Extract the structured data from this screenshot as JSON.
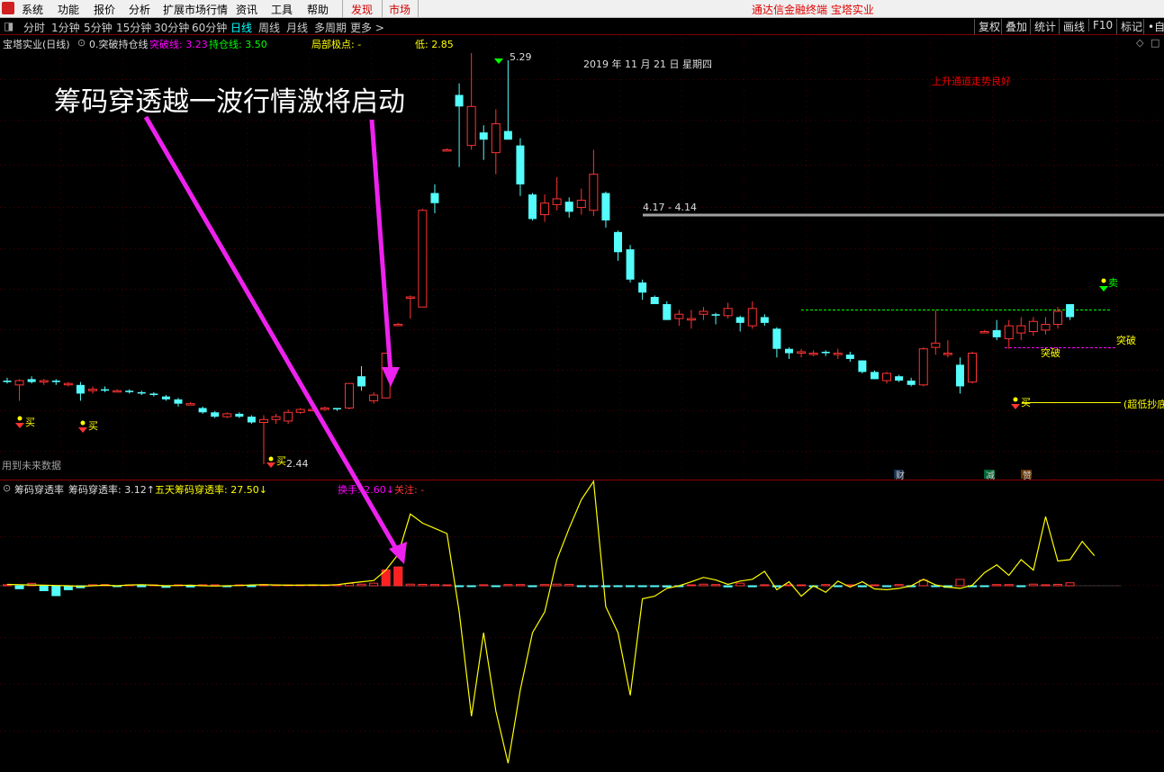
{
  "menubar": {
    "items": [
      "系统",
      "功能",
      "报价",
      "分析",
      "扩展市场行情",
      "资讯",
      "工具",
      "帮助"
    ],
    "discover": "发现",
    "market": "市场",
    "brand": "通达信金融终端  宝塔实业"
  },
  "periods": {
    "items": [
      "分时",
      "1分钟",
      "5分钟",
      "15分钟",
      "30分钟",
      "60分钟",
      "日线",
      "周线",
      "月线",
      "多周期",
      "更多 >"
    ],
    "active": "日线"
  },
  "toolbar_right": [
    "复权",
    "叠加",
    "统计",
    "画线",
    "F10",
    "标记",
    "•自"
  ],
  "main_header": {
    "stock": "宝塔实业(日线)",
    "indicator": "0.突破持仓线",
    "breakout_label": "突破线: 3.23",
    "hold_label": "持仓线: 3.50",
    "local_extreme": "局部极点: -",
    "low": "低: 2.85"
  },
  "date_label": "2019 年 11 月 21 日 星期四",
  "trend_note": "上升通道走势良好",
  "high_price": "5.29",
  "low_price": "2.44",
  "price_line_label": "4.17 - 4.14",
  "future_data_note": "用到未来数据",
  "signals": {
    "buy": "买",
    "sell": "卖",
    "breakout": "突破",
    "ultra_low": "(超低抄底"
  },
  "badges": [
    "财",
    "减",
    "赞"
  ],
  "sub_header": {
    "name": "筹码穿透率",
    "value1": "筹码穿透率: 3.12↑",
    "value2": "五天筹码穿透率: 27.50↓",
    "turnover": "换手: 2.60↓",
    "attention": "关注: -"
  },
  "annotation": "筹码穿透越一波行情激将启动",
  "colors": {
    "up": "#ff3333",
    "down": "#54fcfc",
    "yellow": "#ffff00",
    "magenta": "#ff00ff",
    "green": "#00ff00",
    "gray": "#a0a0a0"
  },
  "chart_data": {
    "type": "candlestick",
    "candles": [
      {
        "o": 3.02,
        "h": 3.04,
        "l": 3.0,
        "c": 3.01
      },
      {
        "o": 2.99,
        "h": 3.03,
        "l": 2.88,
        "c": 3.02
      },
      {
        "o": 3.03,
        "h": 3.05,
        "l": 3.0,
        "c": 3.01
      },
      {
        "o": 3.01,
        "h": 3.03,
        "l": 2.99,
        "c": 3.02
      },
      {
        "o": 3.02,
        "h": 3.03,
        "l": 2.99,
        "c": 3.01
      },
      {
        "o": 3.0,
        "h": 3.01,
        "l": 2.98,
        "c": 3.0
      },
      {
        "o": 2.99,
        "h": 3.01,
        "l": 2.88,
        "c": 2.93
      },
      {
        "o": 2.95,
        "h": 2.98,
        "l": 2.93,
        "c": 2.96
      },
      {
        "o": 2.96,
        "h": 2.98,
        "l": 2.94,
        "c": 2.95
      },
      {
        "o": 2.95,
        "h": 2.96,
        "l": 2.94,
        "c": 2.95
      },
      {
        "o": 2.95,
        "h": 2.96,
        "l": 2.93,
        "c": 2.94
      },
      {
        "o": 2.94,
        "h": 2.95,
        "l": 2.92,
        "c": 2.93
      },
      {
        "o": 2.93,
        "h": 2.94,
        "l": 2.91,
        "c": 2.92
      },
      {
        "o": 2.91,
        "h": 2.92,
        "l": 2.88,
        "c": 2.89
      },
      {
        "o": 2.89,
        "h": 2.9,
        "l": 2.84,
        "c": 2.86
      },
      {
        "o": 2.86,
        "h": 2.87,
        "l": 2.85,
        "c": 2.86
      },
      {
        "o": 2.83,
        "h": 2.84,
        "l": 2.79,
        "c": 2.8
      },
      {
        "o": 2.8,
        "h": 2.81,
        "l": 2.76,
        "c": 2.77
      },
      {
        "o": 2.77,
        "h": 2.8,
        "l": 2.76,
        "c": 2.79
      },
      {
        "o": 2.79,
        "h": 2.8,
        "l": 2.76,
        "c": 2.77
      },
      {
        "o": 2.77,
        "h": 2.78,
        "l": 2.72,
        "c": 2.73
      },
      {
        "o": 2.73,
        "h": 2.78,
        "l": 2.44,
        "c": 2.75
      },
      {
        "o": 2.75,
        "h": 2.79,
        "l": 2.72,
        "c": 2.77
      },
      {
        "o": 2.74,
        "h": 2.82,
        "l": 2.72,
        "c": 2.8
      },
      {
        "o": 2.8,
        "h": 2.83,
        "l": 2.79,
        "c": 2.82
      },
      {
        "o": 2.82,
        "h": 2.84,
        "l": 2.81,
        "c": 2.82
      },
      {
        "o": 2.82,
        "h": 2.84,
        "l": 2.81,
        "c": 2.83
      },
      {
        "o": 2.83,
        "h": 2.83,
        "l": 2.81,
        "c": 2.82
      },
      {
        "o": 2.83,
        "h": 3.0,
        "l": 2.82,
        "c": 3.0
      },
      {
        "o": 3.05,
        "h": 3.12,
        "l": 2.95,
        "c": 2.98
      },
      {
        "o": 2.88,
        "h": 2.94,
        "l": 2.86,
        "c": 2.92
      },
      {
        "o": 2.9,
        "h": 3.21,
        "l": 2.9,
        "c": 3.21
      },
      {
        "o": 3.41,
        "h": 3.42,
        "l": 3.4,
        "c": 3.41
      },
      {
        "o": 3.6,
        "h": 3.61,
        "l": 3.45,
        "c": 3.6
      },
      {
        "o": 3.53,
        "h": 4.21,
        "l": 3.53,
        "c": 4.2
      },
      {
        "o": 4.32,
        "h": 4.38,
        "l": 4.18,
        "c": 4.25
      },
      {
        "o": 4.62,
        "h": 4.63,
        "l": 4.61,
        "c": 4.62
      },
      {
        "o": 5.0,
        "h": 5.08,
        "l": 4.5,
        "c": 4.92
      },
      {
        "o": 4.65,
        "h": 5.29,
        "l": 4.62,
        "c": 4.92
      },
      {
        "o": 4.74,
        "h": 4.79,
        "l": 4.55,
        "c": 4.69
      },
      {
        "o": 4.6,
        "h": 4.9,
        "l": 4.45,
        "c": 4.8
      },
      {
        "o": 4.75,
        "h": 5.24,
        "l": 4.7,
        "c": 4.69
      },
      {
        "o": 4.65,
        "h": 4.7,
        "l": 4.3,
        "c": 4.38
      },
      {
        "o": 4.31,
        "h": 4.32,
        "l": 4.13,
        "c": 4.14
      },
      {
        "o": 4.17,
        "h": 4.31,
        "l": 4.12,
        "c": 4.25
      },
      {
        "o": 4.24,
        "h": 4.43,
        "l": 4.2,
        "c": 4.28
      },
      {
        "o": 4.26,
        "h": 4.29,
        "l": 4.15,
        "c": 4.19
      },
      {
        "o": 4.22,
        "h": 4.35,
        "l": 4.17,
        "c": 4.27
      },
      {
        "o": 4.2,
        "h": 4.62,
        "l": 4.16,
        "c": 4.45
      },
      {
        "o": 4.32,
        "h": 4.33,
        "l": 4.08,
        "c": 4.13
      },
      {
        "o": 4.05,
        "h": 4.06,
        "l": 3.85,
        "c": 3.91
      },
      {
        "o": 3.93,
        "h": 3.96,
        "l": 3.7,
        "c": 3.72
      },
      {
        "o": 3.7,
        "h": 3.72,
        "l": 3.58,
        "c": 3.63
      },
      {
        "o": 3.6,
        "h": 3.61,
        "l": 3.55,
        "c": 3.55
      },
      {
        "o": 3.55,
        "h": 3.57,
        "l": 3.44,
        "c": 3.44
      },
      {
        "o": 3.45,
        "h": 3.51,
        "l": 3.4,
        "c": 3.48
      },
      {
        "o": 3.44,
        "h": 3.51,
        "l": 3.38,
        "c": 3.45
      },
      {
        "o": 3.48,
        "h": 3.53,
        "l": 3.44,
        "c": 3.5
      },
      {
        "o": 3.48,
        "h": 3.49,
        "l": 3.41,
        "c": 3.47
      },
      {
        "o": 3.47,
        "h": 3.56,
        "l": 3.45,
        "c": 3.52
      },
      {
        "o": 3.46,
        "h": 3.47,
        "l": 3.36,
        "c": 3.42
      },
      {
        "o": 3.4,
        "h": 3.57,
        "l": 3.38,
        "c": 3.52
      },
      {
        "o": 3.46,
        "h": 3.48,
        "l": 3.4,
        "c": 3.42
      },
      {
        "o": 3.38,
        "h": 3.39,
        "l": 3.18,
        "c": 3.24
      },
      {
        "o": 3.24,
        "h": 3.25,
        "l": 3.17,
        "c": 3.21
      },
      {
        "o": 3.21,
        "h": 3.24,
        "l": 3.18,
        "c": 3.22
      },
      {
        "o": 3.21,
        "h": 3.23,
        "l": 3.19,
        "c": 3.21
      },
      {
        "o": 3.22,
        "h": 3.23,
        "l": 3.19,
        "c": 3.21
      },
      {
        "o": 3.2,
        "h": 3.24,
        "l": 3.17,
        "c": 3.21
      },
      {
        "o": 3.2,
        "h": 3.22,
        "l": 3.15,
        "c": 3.17
      },
      {
        "o": 3.16,
        "h": 3.16,
        "l": 3.07,
        "c": 3.08
      },
      {
        "o": 3.08,
        "h": 3.09,
        "l": 3.03,
        "c": 3.03
      },
      {
        "o": 3.02,
        "h": 3.08,
        "l": 3.0,
        "c": 3.07
      },
      {
        "o": 3.05,
        "h": 3.06,
        "l": 3.01,
        "c": 3.02
      },
      {
        "o": 3.02,
        "h": 3.04,
        "l": 2.98,
        "c": 2.99
      },
      {
        "o": 2.99,
        "h": 3.25,
        "l": 2.98,
        "c": 3.24
      },
      {
        "o": 3.25,
        "h": 3.51,
        "l": 3.2,
        "c": 3.28
      },
      {
        "o": 3.2,
        "h": 3.3,
        "l": 3.18,
        "c": 3.21
      },
      {
        "o": 3.13,
        "h": 3.18,
        "l": 2.93,
        "c": 2.98
      },
      {
        "o": 3.01,
        "h": 3.22,
        "l": 3.0,
        "c": 3.21
      },
      {
        "o": 3.36,
        "h": 3.37,
        "l": 3.35,
        "c": 3.36
      },
      {
        "o": 3.37,
        "h": 3.44,
        "l": 3.3,
        "c": 3.32
      },
      {
        "o": 3.31,
        "h": 3.44,
        "l": 3.24,
        "c": 3.4
      },
      {
        "o": 3.35,
        "h": 3.46,
        "l": 3.3,
        "c": 3.4
      },
      {
        "o": 3.36,
        "h": 3.46,
        "l": 3.33,
        "c": 3.43
      },
      {
        "o": 3.37,
        "h": 3.46,
        "l": 3.34,
        "c": 3.41
      },
      {
        "o": 3.41,
        "h": 3.53,
        "l": 3.38,
        "c": 3.5
      },
      {
        "o": 3.55,
        "h": 3.55,
        "l": 3.44,
        "c": 3.46
      }
    ],
    "penetration_bars": [
      0.5,
      -1.5,
      1.2,
      -2.5,
      -5,
      -2,
      -1,
      0.5,
      0.6,
      -0.3,
      0.2,
      -0.5,
      0.4,
      -0.8,
      0.3,
      -0.6,
      0.5,
      0.4,
      -0.5,
      0.3,
      -0.4,
      0.6,
      0.3,
      0.2,
      0.4,
      0.3,
      0.2,
      0.5,
      1.2,
      0.8,
      1.3,
      8,
      9.5,
      0.8,
      0.7,
      0.6,
      0.3,
      -0.3,
      -0.4,
      0.5,
      -0.4,
      0.6,
      0.6,
      -0.4,
      0.6,
      0.8,
      0.7,
      -0.4,
      -0.3,
      -0.5,
      -0.4,
      -0.3,
      -0.4,
      -0.3,
      -0.6,
      -0.4,
      0.4,
      0.8,
      0.6,
      -0.6,
      1.3,
      -0.5,
      0.5,
      -0.5,
      0.4,
      0.4,
      -0.4,
      0.6,
      -0.3,
      0.3,
      -0.5,
      0.2,
      -0.4,
      0.6,
      -0.5,
      2.8,
      -0.4,
      -0.8,
      3.2,
      -0.5,
      -0.4,
      0.6,
      0.6,
      -0.4,
      0.8,
      0.5,
      0.7,
      1.5
    ],
    "five_day_line": [
      0.5,
      0.4,
      0.3,
      0.2,
      0.1,
      0,
      -0.2,
      0,
      0.2,
      0,
      0.3,
      0.4,
      0.2,
      0,
      0.1,
      0.2,
      0,
      -0.1,
      0,
      0.1,
      0.3,
      0.4,
      0.3,
      0.2,
      0.2,
      0.3,
      0.2,
      0.4,
      1.0,
      1.5,
      2.0,
      6.0,
      12,
      27.5,
      24,
      22,
      20,
      -10,
      -50,
      -18,
      -48,
      -68,
      -40,
      -18,
      -10,
      10,
      22,
      33,
      40,
      -8,
      -18,
      -42,
      -5,
      -4,
      -1,
      0,
      1.5,
      3.2,
      2.2,
      0.5,
      1.8,
      2.5,
      5.5,
      -1.5,
      1.5,
      -4,
      0,
      -2.5,
      1.8,
      -0.5,
      1.5,
      -1.2,
      -1.5,
      -1.0,
      0,
      2.5,
      0.3,
      -0.5,
      -1.0,
      0.2,
      5.0,
      8.0,
      4.0,
      10,
      6.0,
      26.5,
      9.5,
      10,
      17,
      11.5
    ]
  }
}
